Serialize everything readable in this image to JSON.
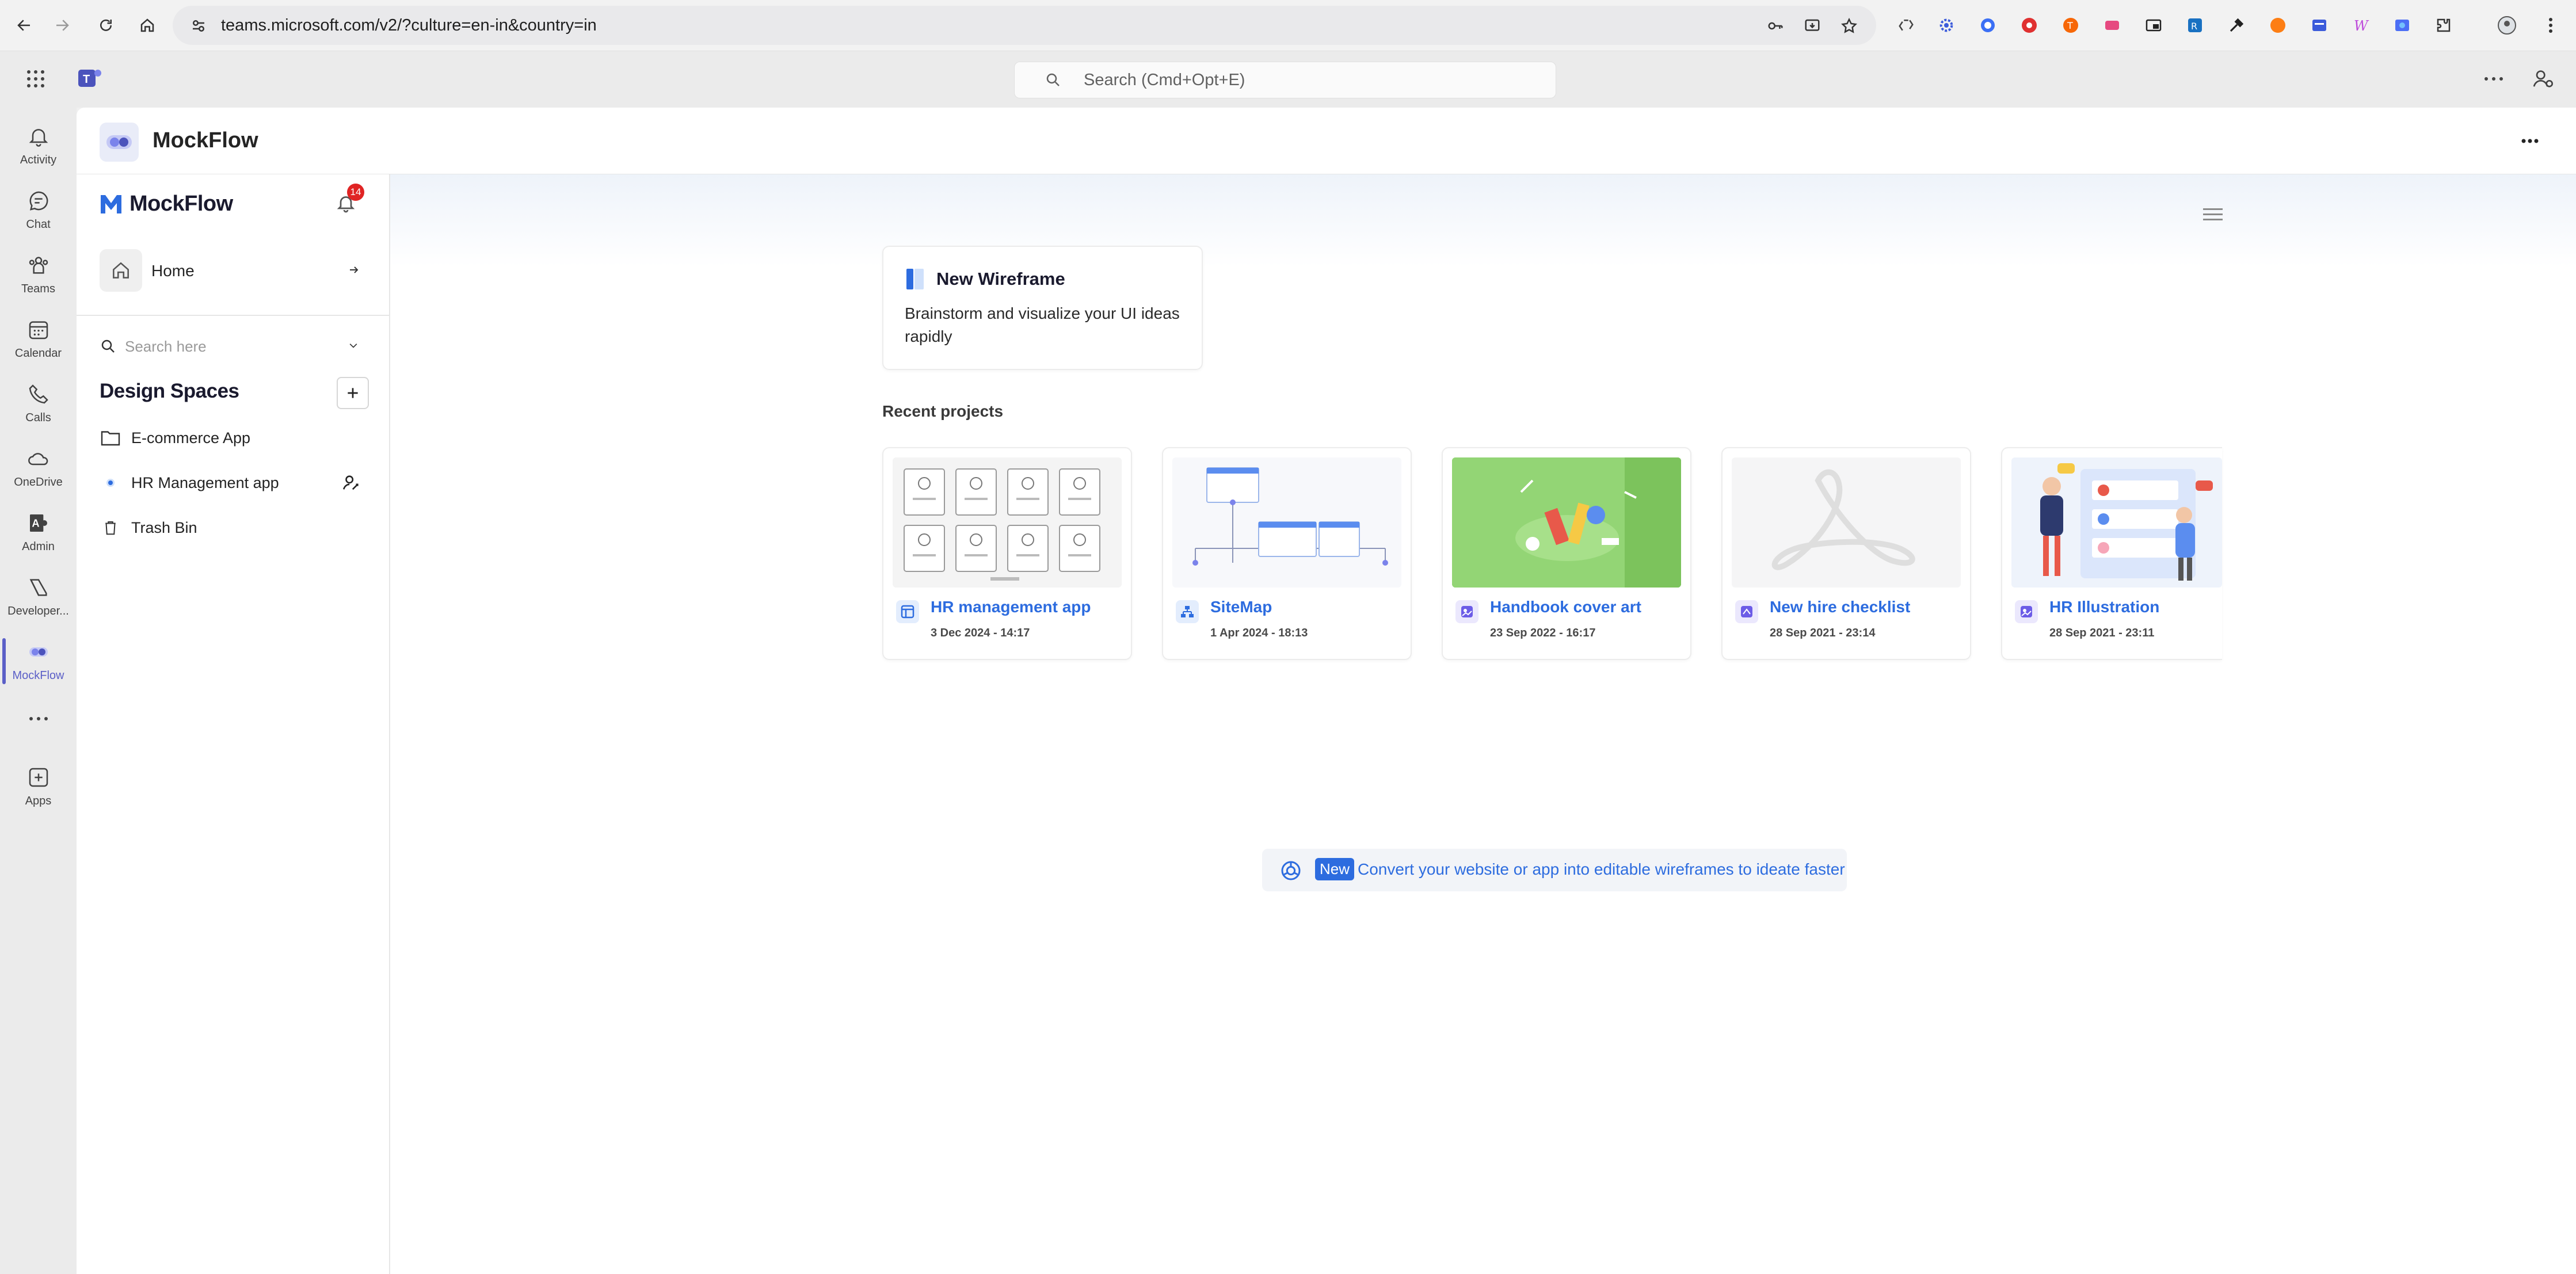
{
  "browser": {
    "url": "teams.microsoft.com/v2/?culture=en-in&country=in"
  },
  "teams": {
    "search_placeholder": "Search (Cmd+Opt+E)",
    "rail": [
      {
        "label": "Activity",
        "icon": "bell-icon"
      },
      {
        "label": "Chat",
        "icon": "chat-icon"
      },
      {
        "label": "Teams",
        "icon": "teams-icon"
      },
      {
        "label": "Calendar",
        "icon": "calendar-icon"
      },
      {
        "label": "Calls",
        "icon": "phone-icon"
      },
      {
        "label": "OneDrive",
        "icon": "cloud-icon"
      },
      {
        "label": "Admin",
        "icon": "admin-icon"
      },
      {
        "label": "Developer...",
        "icon": "developer-icon"
      },
      {
        "label": "MockFlow",
        "icon": "mockflow-icon",
        "active": true
      },
      {
        "label": "Apps",
        "icon": "plus-icon"
      }
    ],
    "accent": "#5b5fc7"
  },
  "app": {
    "title": "MockFlow"
  },
  "sidebar": {
    "brand": "MockFlow",
    "notification_count": "14",
    "home_label": "Home",
    "search_placeholder": "Search here",
    "design_spaces_title": "Design Spaces",
    "items": [
      {
        "label": "E-commerce App",
        "icon": "folder-icon"
      },
      {
        "label": "HR Management app",
        "icon": "dot-icon"
      },
      {
        "label": "Trash Bin",
        "icon": "trash-icon"
      }
    ]
  },
  "main": {
    "new_wireframe_title": "New Wireframe",
    "new_wireframe_desc": "Brainstorm and visualize your UI ideas rapidly",
    "recent_title": "Recent projects",
    "projects": [
      {
        "name": "HR management app",
        "date": "3 Dec 2024 - 14:17"
      },
      {
        "name": "SiteMap",
        "date": "1 Apr 2024 - 18:13"
      },
      {
        "name": "Handbook cover art",
        "date": "23 Sep 2022 - 16:17"
      },
      {
        "name": "New hire checklist",
        "date": "28 Sep 2021 - 23:14"
      },
      {
        "name": "HR Illustration",
        "date": "28 Sep 2021 - 23:11"
      }
    ],
    "banner_badge": "New",
    "banner_text": "Convert your website or app into editable wireframes to ideate faster",
    "link_color": "#2d6cdf"
  }
}
